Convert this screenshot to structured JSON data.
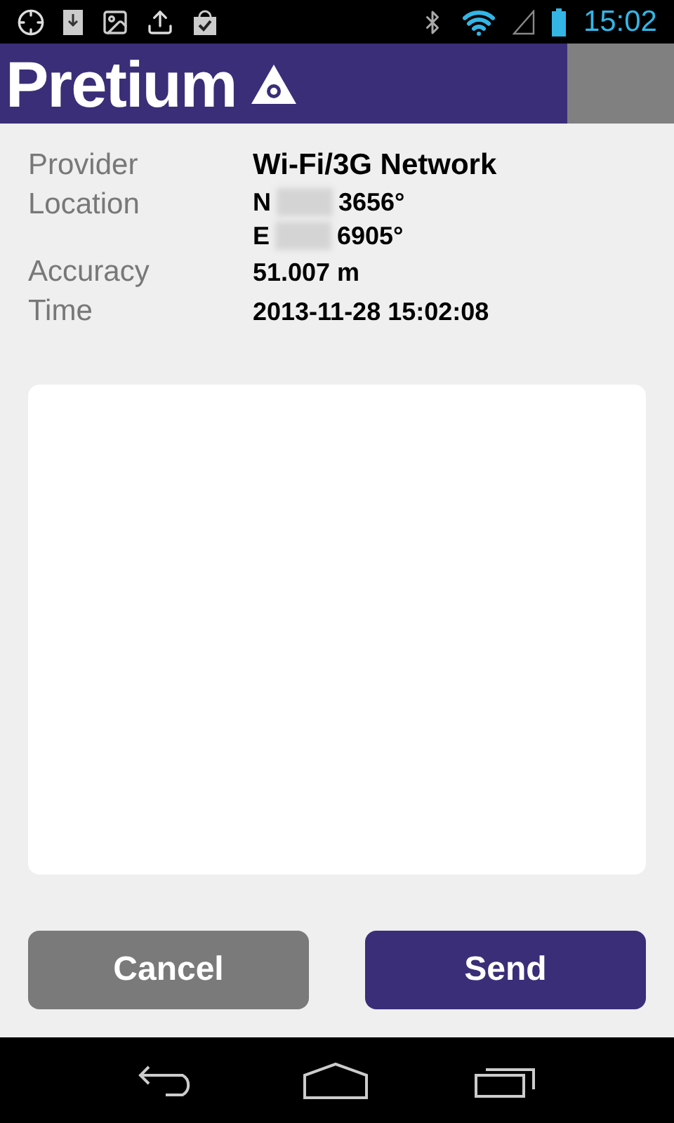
{
  "status_bar": {
    "time": "15:02"
  },
  "header": {
    "logo": "Pretium"
  },
  "info": [
    {
      "label": "Provider",
      "values": [
        {
          "text": "Wi-Fi/3G Network"
        }
      ],
      "kind": "title"
    },
    {
      "label": "Location",
      "values": [
        {
          "prefix": "N",
          "text": "3656°",
          "redacted": true
        },
        {
          "prefix": "E",
          "text": "6905°",
          "redacted": true
        }
      ],
      "kind": "plain"
    },
    {
      "label": "Accuracy",
      "values": [
        {
          "text": "51.007 m"
        }
      ],
      "kind": "plain"
    },
    {
      "label": "Time",
      "values": [
        {
          "text": "2013-11-28 15:02:08"
        }
      ],
      "kind": "plain"
    }
  ],
  "buttons": [
    {
      "label": "Cancel",
      "kind": "secondary"
    },
    {
      "label": "Send",
      "kind": "primary"
    }
  ]
}
